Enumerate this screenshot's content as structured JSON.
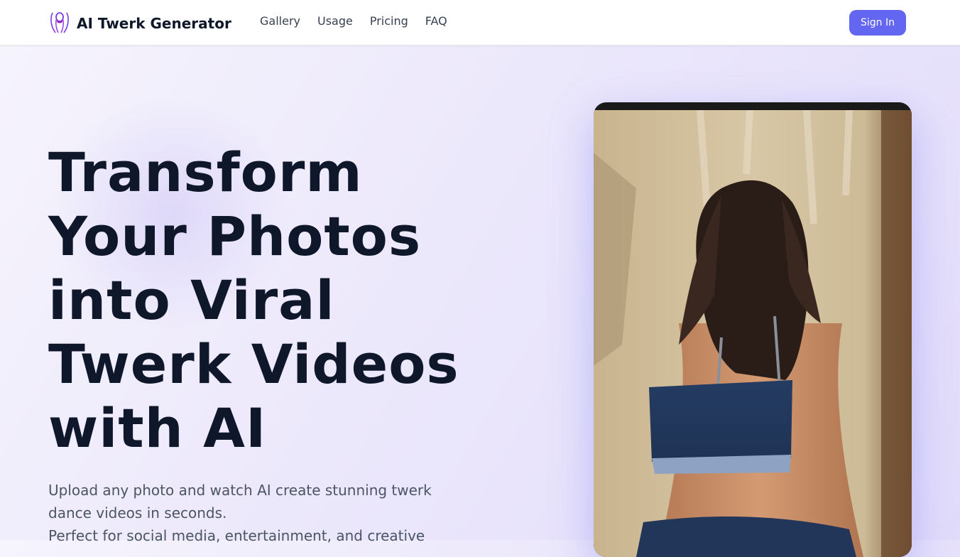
{
  "header": {
    "brand_name": "AI Twerk Generator",
    "logo_icon": "peach-dancer-logo-icon",
    "nav": [
      {
        "label": "Gallery"
      },
      {
        "label": "Usage"
      },
      {
        "label": "Pricing"
      },
      {
        "label": "FAQ"
      }
    ],
    "sign_in_label": "Sign In"
  },
  "hero": {
    "title_lines": [
      "Transform",
      "Your Photos",
      "into Viral",
      "Twerk Videos",
      "with AI"
    ],
    "subtitle_lines": [
      "Upload any photo and watch AI create stunning twerk",
      "dance videos in seconds.",
      "Perfect for social media, entertainment, and creative"
    ]
  },
  "colors": {
    "accent": "#6366f1",
    "heading": "#0f172a",
    "body_text": "#4b5563",
    "nav_text": "#374151"
  }
}
